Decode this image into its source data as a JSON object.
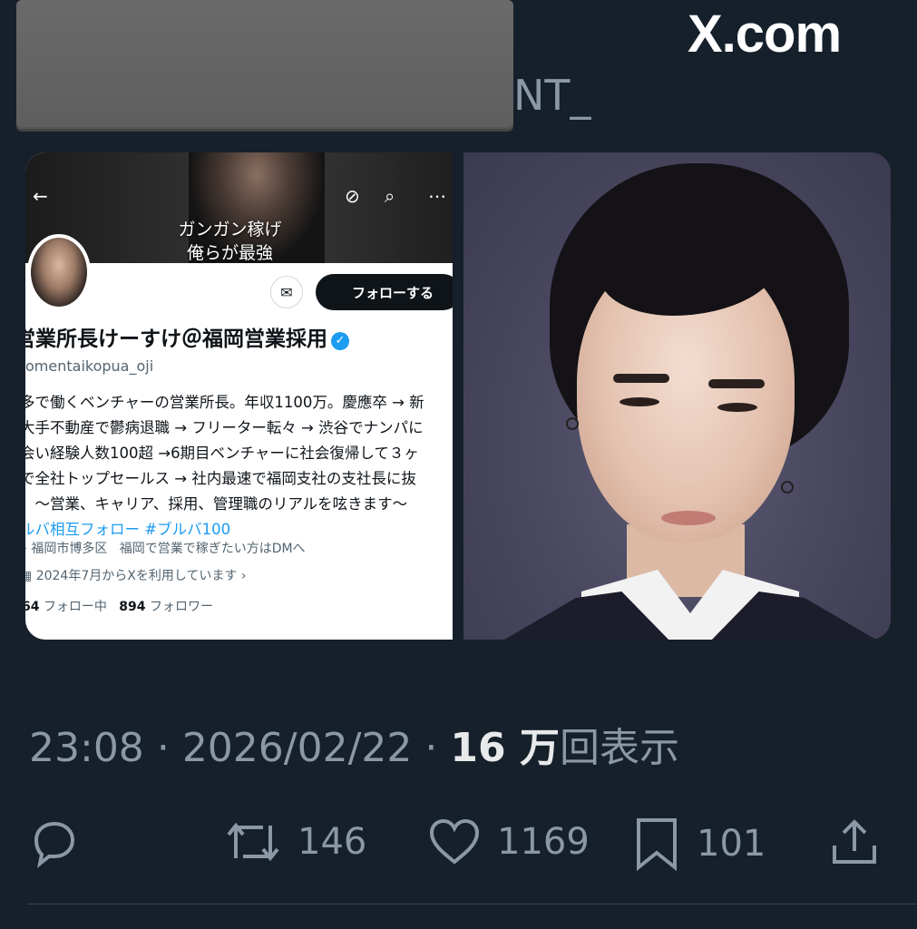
{
  "header": {
    "handle_visible_tail": "NT_",
    "watermark": "X.com"
  },
  "screenshot_profile": {
    "banner_line1": "ガンガン稼げ",
    "banner_line2": "俺らが最強",
    "mail_icon": "mail-icon",
    "follow_label": "フォローする",
    "display_name": "営業所長けーすけ＠福岡営業採用",
    "handle": "omentaikopua_oji",
    "bio_lines": [
      "多で働くベンチャーの営業所長。年収1100万。慶應卒 → 新",
      "大手不動産で鬱病退職 → フリーター転々 → 渋谷でナンパに",
      "会い経験人数100超 →6期目ベンチャーに社会復帰して３ヶ",
      "で全社トップセールス → 社内最速で福岡支社の支社長に抜",
      "。〜営業、キャリア、採用、管理職のリアルを呟きます〜"
    ],
    "hashtags": "ルバ相互フォロー #ブルバ100",
    "location": "福岡市博多区",
    "website_text": "福岡で営業で稼ぎたい方はDMへ",
    "joined": "2024年7月からXを利用しています",
    "following_count": "64",
    "following_label": "フォロー中",
    "followers_count": "894",
    "followers_label": "フォロワー"
  },
  "tweet_meta": {
    "time": "23:08",
    "date": "2026/02/22",
    "views_number": "16 万",
    "views_label": "回表示",
    "separator": "·"
  },
  "actions": {
    "reply_icon": "reply-icon",
    "retweet_icon": "retweet-icon",
    "retweet_count": "146",
    "like_icon": "heart-icon",
    "like_count": "1169",
    "bookmark_icon": "bookmark-icon",
    "bookmark_count": "101",
    "share_icon": "share-icon"
  },
  "colors": {
    "background": "#15202b",
    "secondary_text": "#8b98a5",
    "accent": "#1d9bf0"
  }
}
